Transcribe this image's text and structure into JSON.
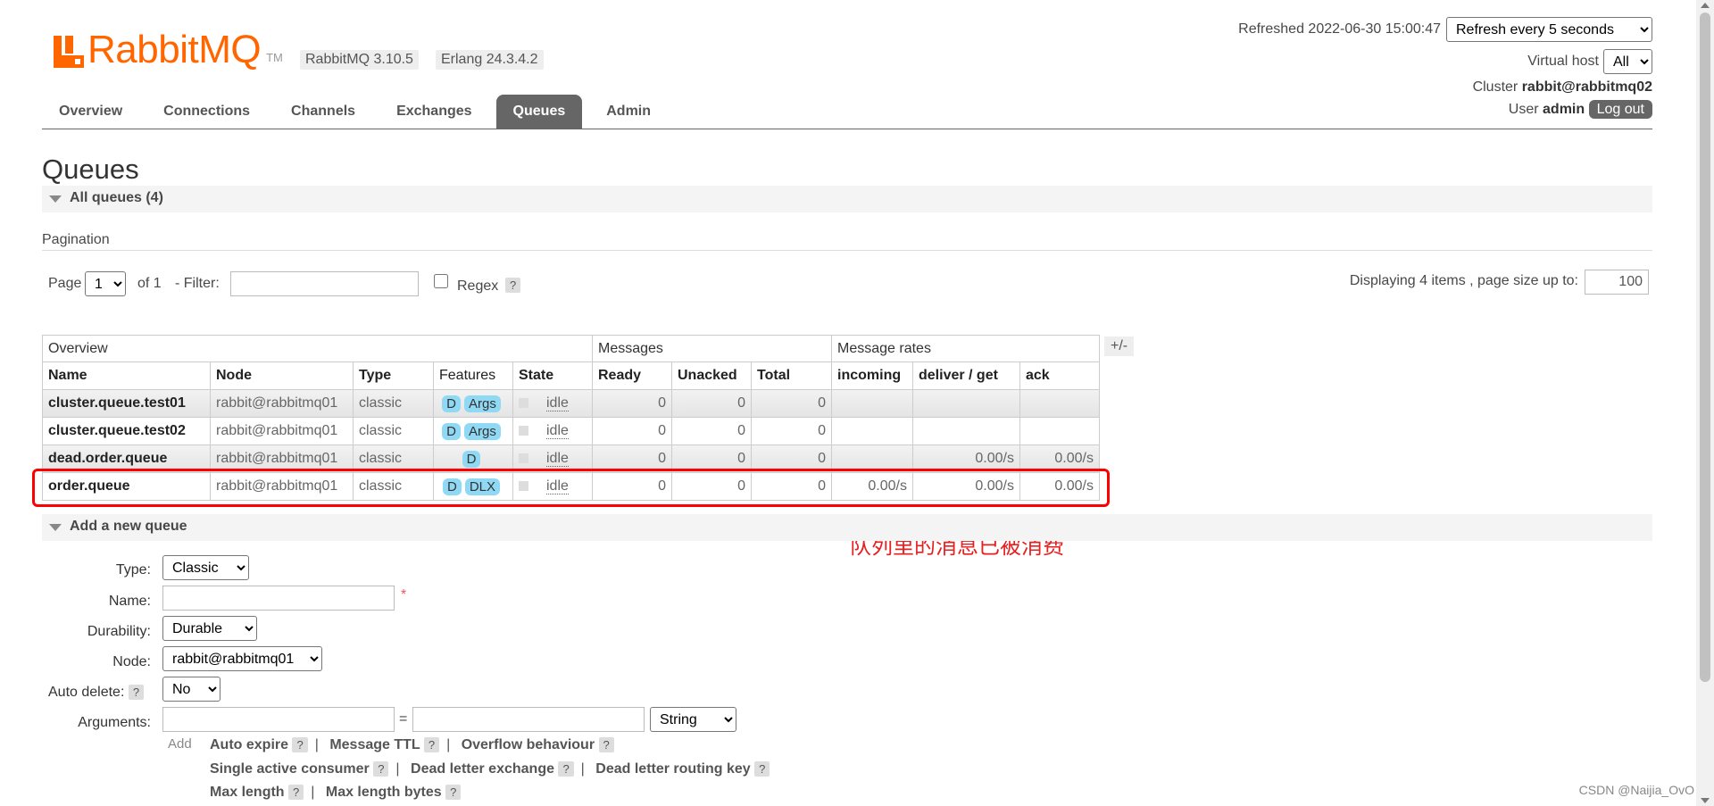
{
  "header": {
    "logo_text": "RabbitMQ",
    "logo_tm": "TM",
    "version": "RabbitMQ 3.10.5",
    "erlang": "Erlang 24.3.4.2",
    "refreshed": "Refreshed 2022-06-30 15:00:47",
    "refresh_option": "Refresh every 5 seconds",
    "virtual_host_label": "Virtual host",
    "virtual_host_value": "All",
    "cluster_label": "Cluster",
    "cluster_value": "rabbit@rabbitmq02",
    "user_label": "User",
    "user_value": "admin",
    "logout_label": "Log out"
  },
  "nav": {
    "tabs": [
      "Overview",
      "Connections",
      "Channels",
      "Exchanges",
      "Queues",
      "Admin"
    ],
    "active": "Queues"
  },
  "page_title": "Queues",
  "all_queues_section": "All queues (4)",
  "pagination": {
    "heading": "Pagination",
    "page_label": "Page",
    "page_value": "1",
    "of_label": "of 1",
    "filter_label": "- Filter:",
    "filter_value": "",
    "regex_label": "Regex",
    "help": "?",
    "displaying": "Displaying 4 items , page size up to:",
    "page_size": "100"
  },
  "table": {
    "groups": [
      "Overview",
      "Messages",
      "Message rates"
    ],
    "toggle": "+/-",
    "columns": [
      "Name",
      "Node",
      "Type",
      "Features",
      "State",
      "Ready",
      "Unacked",
      "Total",
      "incoming",
      "deliver / get",
      "ack"
    ],
    "rows": [
      {
        "name": "cluster.queue.test01",
        "node": "rabbit@rabbitmq01",
        "type": "classic",
        "features": [
          "D",
          "Args"
        ],
        "state": "idle",
        "ready": "0",
        "unacked": "0",
        "total": "0",
        "incoming": "",
        "deliver_get": "",
        "ack": ""
      },
      {
        "name": "cluster.queue.test02",
        "node": "rabbit@rabbitmq01",
        "type": "classic",
        "features": [
          "D",
          "Args"
        ],
        "state": "idle",
        "ready": "0",
        "unacked": "0",
        "total": "0",
        "incoming": "",
        "deliver_get": "",
        "ack": ""
      },
      {
        "name": "dead.order.queue",
        "node": "rabbit@rabbitmq01",
        "type": "classic",
        "features": [
          "D"
        ],
        "state": "idle",
        "ready": "0",
        "unacked": "0",
        "total": "0",
        "incoming": "",
        "deliver_get": "0.00/s",
        "ack": "0.00/s"
      },
      {
        "name": "order.queue",
        "node": "rabbit@rabbitmq01",
        "type": "classic",
        "features": [
          "D",
          "DLX"
        ],
        "state": "idle",
        "ready": "0",
        "unacked": "0",
        "total": "0",
        "incoming": "0.00/s",
        "deliver_get": "0.00/s",
        "ack": "0.00/s"
      }
    ]
  },
  "annotation": "队列里的消息已被消费",
  "add_queue": {
    "section": "Add a new queue",
    "type_label": "Type:",
    "type_value": "Classic",
    "name_label": "Name:",
    "name_required": "*",
    "durability_label": "Durability:",
    "durability_value": "Durable",
    "node_label": "Node:",
    "node_value": "rabbit@rabbitmq01",
    "auto_delete_label": "Auto delete:",
    "auto_delete_value": "No",
    "arguments_label": "Arguments:",
    "equals": "=",
    "arg_type_value": "String",
    "add_label": "Add",
    "arg_links_row1": [
      "Auto expire",
      "Message TTL",
      "Overflow behaviour"
    ],
    "arg_links_row2": [
      "Single active consumer",
      "Dead letter exchange",
      "Dead letter routing key"
    ],
    "arg_links_row3": [
      "Max length",
      "Max length bytes"
    ]
  },
  "watermark": "CSDN @Naijia_OvO"
}
